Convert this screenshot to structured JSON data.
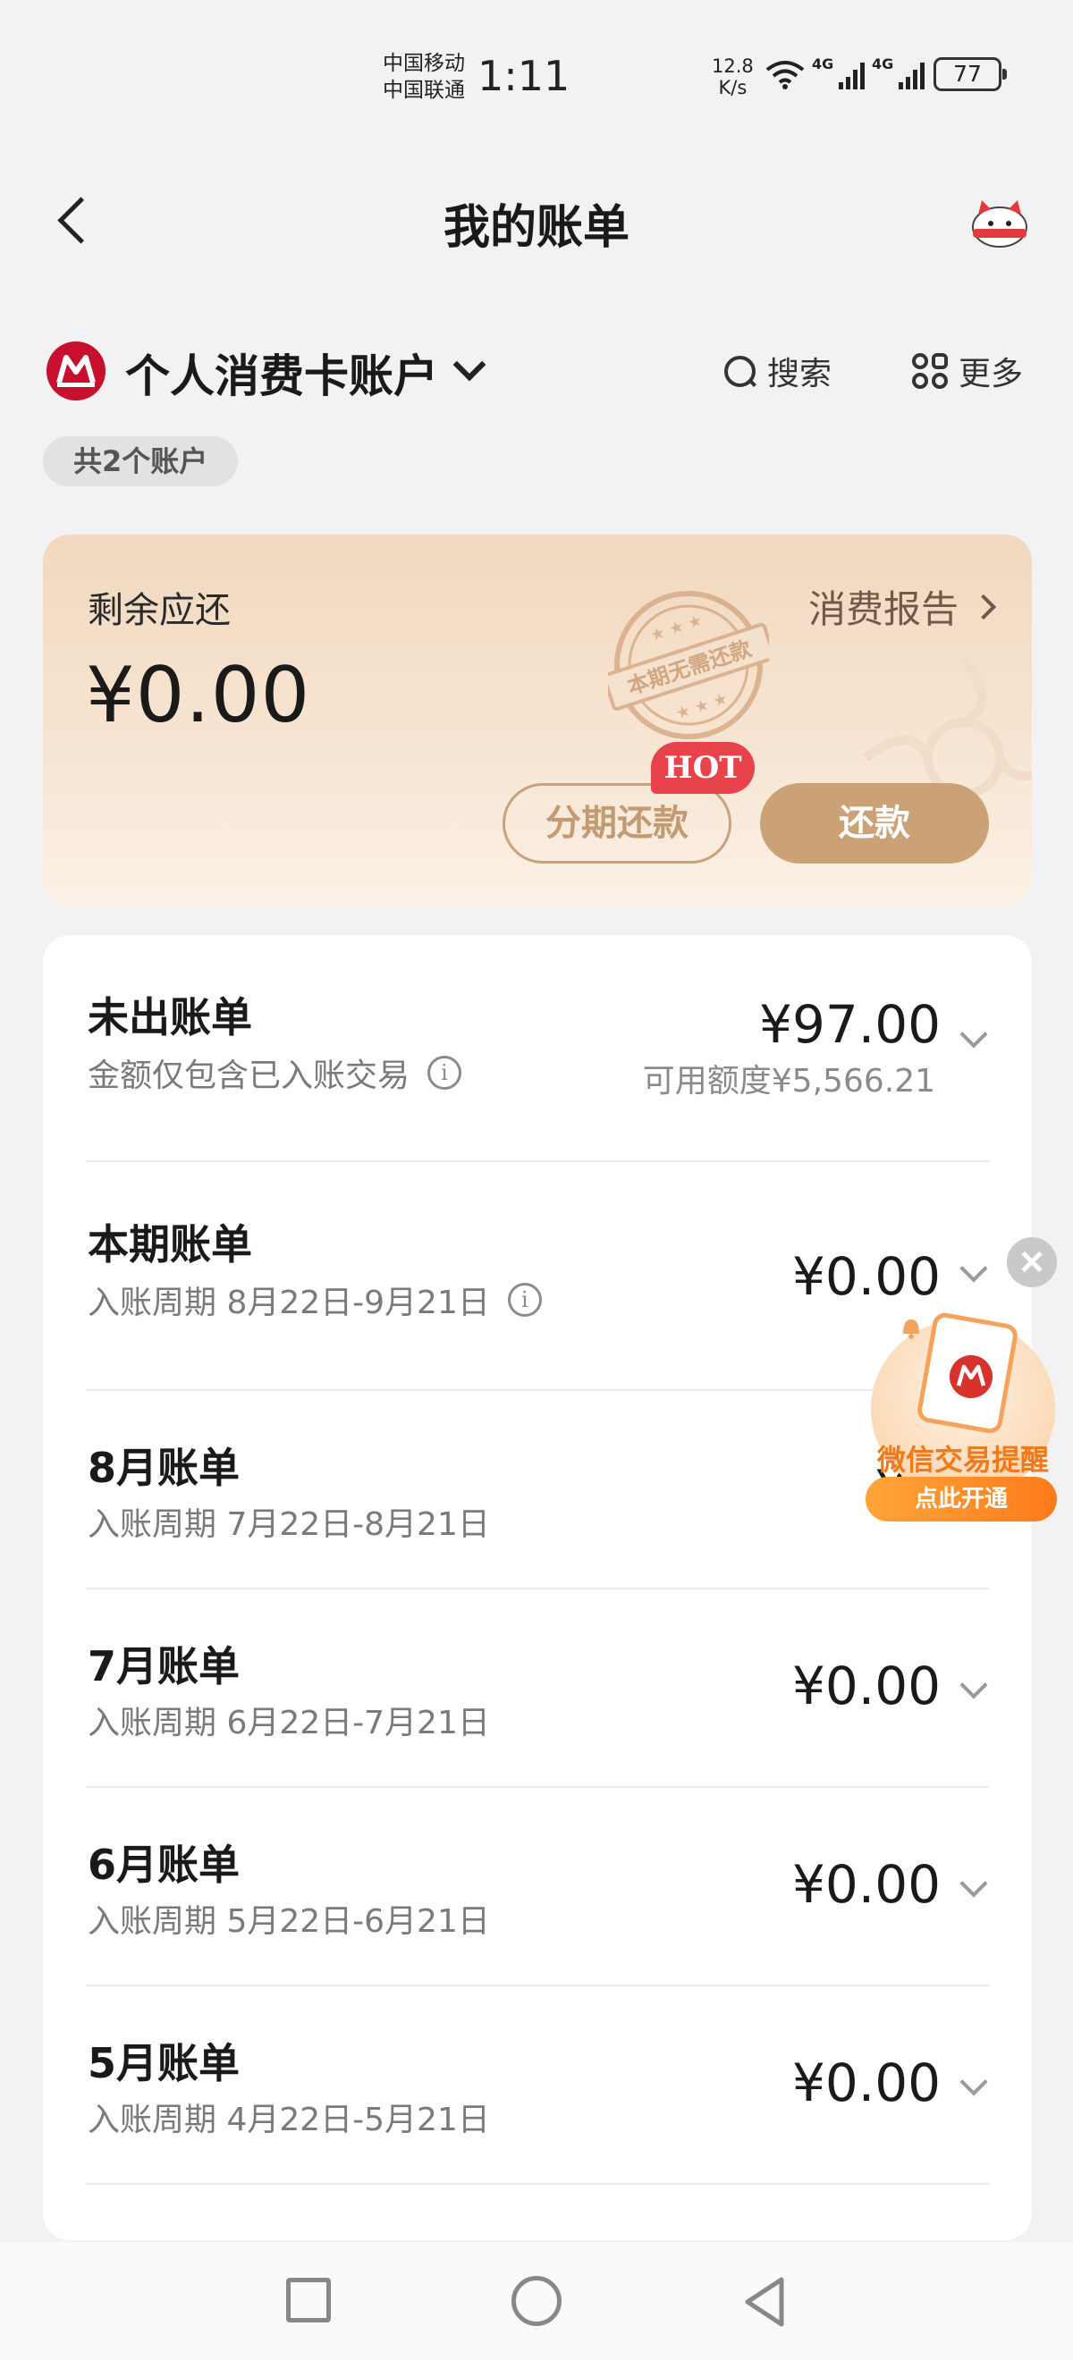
{
  "status_bar": {
    "carrier1": "中国移动",
    "carrier2": "中国联通",
    "time": "1:11",
    "net_speed_value": "12.8",
    "net_speed_unit": "K/s",
    "network1": "4G",
    "network2": "4G",
    "battery": "77"
  },
  "header": {
    "title": "我的账单"
  },
  "account": {
    "name": "个人消费卡账户",
    "search_label": "搜索",
    "more_label": "更多",
    "count_badge": "共2个账户"
  },
  "balance": {
    "label": "剩余应还",
    "amount": "¥0.00",
    "report_link": "消费报告",
    "stamp_text": "本期无需还款",
    "installment_button": "分期还款",
    "hot_badge": "HOT",
    "pay_button": "还款"
  },
  "bills": [
    {
      "title": "未出账单",
      "subtitle": "金额仅包含已入账交易",
      "amount": "¥97.00",
      "extra": "可用额度¥5,566.21"
    },
    {
      "title": "本期账单",
      "subtitle": "入账周期 8月22日-9月21日",
      "amount": "¥0.00"
    },
    {
      "title": "8月账单",
      "subtitle": "入账周期 7月22日-8月21日",
      "amount": "¥0"
    },
    {
      "title": "7月账单",
      "subtitle": "入账周期 6月22日-7月21日",
      "amount": "¥0.00"
    },
    {
      "title": "6月账单",
      "subtitle": "入账周期 5月22日-6月21日",
      "amount": "¥0.00"
    },
    {
      "title": "5月账单",
      "subtitle": "入账周期 4月22日-5月21日",
      "amount": "¥0.00"
    }
  ],
  "promo": {
    "title": "微信交易提醒",
    "button": "点此开通"
  },
  "colors": {
    "brand_red": "#c8102e",
    "gold": "#caa276",
    "hot_red": "#e8424b",
    "promo_orange": "#ff7a1a"
  }
}
